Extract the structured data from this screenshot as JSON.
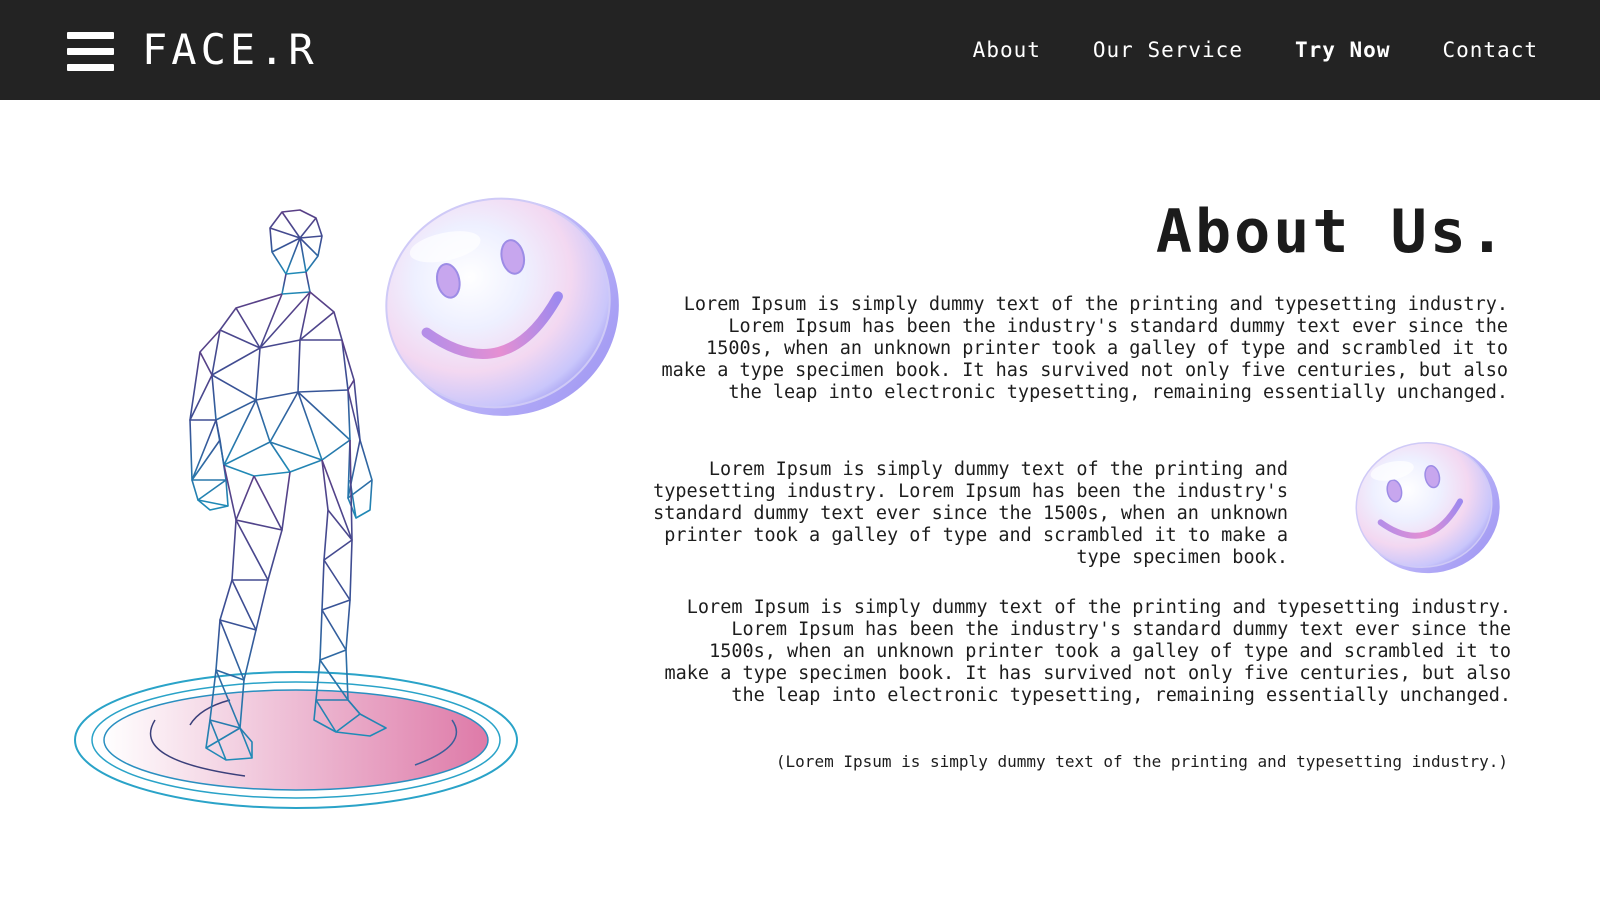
{
  "header": {
    "logo": "FACE.R",
    "menu_icon": "hamburger-menu-icon",
    "nav": [
      {
        "label": "About"
      },
      {
        "label": "Our Service"
      },
      {
        "label": "Try Now"
      },
      {
        "label": "Contact"
      }
    ],
    "background_color": "#232323"
  },
  "main": {
    "heading": "About Us.",
    "paragraphs": [
      "Lorem Ipsum is simply dummy text of the printing and typesetting industry. Lorem Ipsum has been the industry's standard dummy text ever since the 1500s, when an unknown printer took a galley of type and scrambled it to make a type specimen book. It has survived not only five centuries, but also the leap into electronic typesetting, remaining essentially unchanged.",
      "Lorem Ipsum is simply dummy text of the printing and typesetting industry. Lorem Ipsum has been the industry's standard dummy text ever since the 1500s, when an unknown printer took a galley of type and scrambled it to make a type specimen book.",
      "Lorem Ipsum is simply dummy text of the printing and typesetting industry. Lorem Ipsum has been the industry's standard dummy text ever since the 1500s, when an unknown printer took a galley of type and scrambled it to make a type specimen book. It has survived not only five centuries, but also the leap into electronic typesetting, remaining essentially unchanged."
    ],
    "note": "(Lorem Ipsum is simply dummy text of the printing and typesetting industry.)"
  },
  "illustrations": {
    "figure": "wireframe-human-figure",
    "platform": "pink-gradient-platform",
    "smiley": "holographic-smiley-icon"
  },
  "colors": {
    "accent_pink": "#de7aa8",
    "accent_blue": "#2aa3c8",
    "accent_purple": "#8a7ff0",
    "text": "#1c1c1c"
  }
}
